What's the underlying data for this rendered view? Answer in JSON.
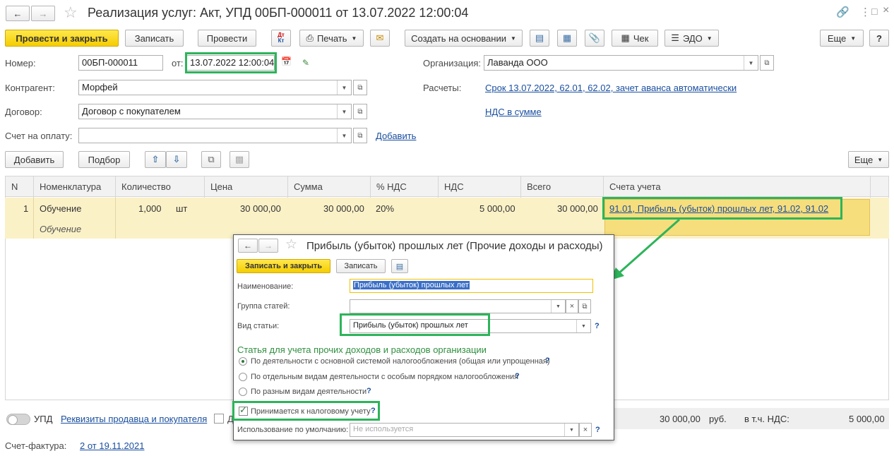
{
  "window": {
    "title": "Реализация услуг: Акт, УПД 00БП-000011 от 13.07.2022 12:00:04"
  },
  "toolbar": {
    "post_close": "Провести и закрыть",
    "save": "Записать",
    "post": "Провести",
    "print": "Печать",
    "create_based": "Создать на основании",
    "receipt": "Чек",
    "edo": "ЭДО",
    "more": "Еще",
    "help": "?"
  },
  "form": {
    "number_label": "Номер:",
    "number_value": "00БП-000011",
    "date_label": "от:",
    "date_value": "13.07.2022 12:00:04",
    "org_label": "Организация:",
    "org_value": "Лаванда ООО",
    "counterparty_label": "Контрагент:",
    "counterparty_value": "Морфей",
    "settlements_label": "Расчеты:",
    "settlements_link": "Срок 13.07.2022, 62.01, 62.02, зачет аванса автоматически",
    "contract_label": "Договор:",
    "contract_value": "Договор с покупателем",
    "vat_link": "НДС в сумме",
    "invoice_label": "Счет на оплату:",
    "invoice_value": "",
    "add_link": "Добавить"
  },
  "table_toolbar": {
    "add": "Добавить",
    "pick": "Подбор",
    "more": "Еще"
  },
  "table": {
    "columns": [
      "N",
      "Номенклатура",
      "Количество",
      "Цена",
      "Сумма",
      "% НДС",
      "НДС",
      "Всего",
      "Счета учета"
    ],
    "row": {
      "n": "1",
      "item": "Обучение",
      "item_sub": "Обучение",
      "qty": "1,000",
      "unit": "шт",
      "price": "30 000,00",
      "sum": "30 000,00",
      "vat_rate": "20%",
      "vat": "5 000,00",
      "total": "30 000,00",
      "accounts": "91.01, Прибыль (убыток) прошлых лет, 91.02, 91.02"
    }
  },
  "footer": {
    "upd_label": "УПД",
    "details_link": "Реквизиты продавца и покупателя",
    "checkbox_partial": "Д",
    "total_value": "30 000,00",
    "currency": "руб.",
    "vat_label": "в т.ч. НДС:",
    "vat_value": "5 000,00",
    "invoice_label": "Счет-фактура:",
    "invoice_link": "2 от 19.11.2021"
  },
  "popup": {
    "title": "Прибыль (убыток) прошлых лет (Прочие доходы и расходы)",
    "save_close": "Записать и закрыть",
    "save": "Записать",
    "name_label": "Наименование:",
    "name_value": "Прибыль (убыток) прошлых лет",
    "group_label": "Группа статей:",
    "group_value": "",
    "kind_label": "Вид статьи:",
    "kind_value": "Прибыль (убыток) прошлых лет",
    "section_title": "Статья для учета прочих доходов и расходов организации",
    "radio1": "По деятельности с основной системой налогообложения (общая или упрощенная)",
    "radio2": "По отдельным видам деятельности с особым порядком налогообложения",
    "radio3": "По разным видам деятельности",
    "checkbox_label": "Принимается к налоговому учету",
    "usage_label": "Использование по умолчанию:",
    "usage_placeholder": "Не используется",
    "q": "?"
  },
  "colors": {
    "accent_green": "#2db45a",
    "link_blue": "#1a4fa0",
    "primary_yellow": "#f4cd00",
    "row_highlight": "#fbf1c7"
  }
}
